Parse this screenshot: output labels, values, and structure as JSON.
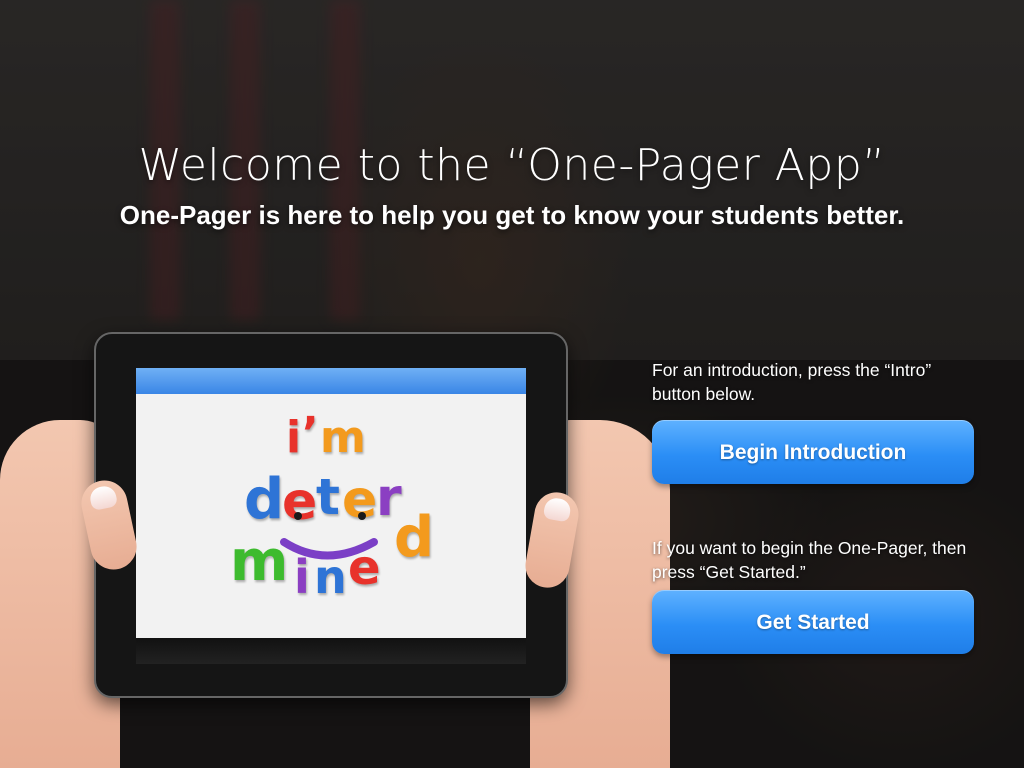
{
  "header": {
    "title": "Welcome to the “One-Pager App”",
    "subtitle": "One-Pager is here to help you get to know your students better."
  },
  "tablet": {
    "logo_letters": [
      {
        "char": "i",
        "color": "#e8322b"
      },
      {
        "char": "’",
        "color": "#e8322b"
      },
      {
        "char": "m",
        "color": "#f39a1d"
      },
      {
        "char": "d",
        "color": "#2e74d6"
      },
      {
        "char": "e",
        "color": "#e8322b"
      },
      {
        "char": "t",
        "color": "#2e74d6"
      },
      {
        "char": "e",
        "color": "#f39a1d"
      },
      {
        "char": "r",
        "color": "#8b3fc2"
      },
      {
        "char": "m",
        "color": "#3dbb2e"
      },
      {
        "char": "i",
        "color": "#8b3fc2"
      },
      {
        "char": "n",
        "color": "#2e74d6"
      },
      {
        "char": "e",
        "color": "#e8322b"
      },
      {
        "char": "d",
        "color": "#f39a1d"
      }
    ],
    "colors": {
      "smile": "#7b3fc6",
      "eyes": "#1a1a1a"
    }
  },
  "intro": {
    "text": "For an introduction, press the “Intro” button below.",
    "button_label": "Begin Introduction"
  },
  "start": {
    "text": "If you want to begin the One-Pager, then press “Get Started.”",
    "button_label": "Get Started"
  },
  "colors": {
    "button": "#2b8ef6",
    "text": "#ffffff"
  }
}
